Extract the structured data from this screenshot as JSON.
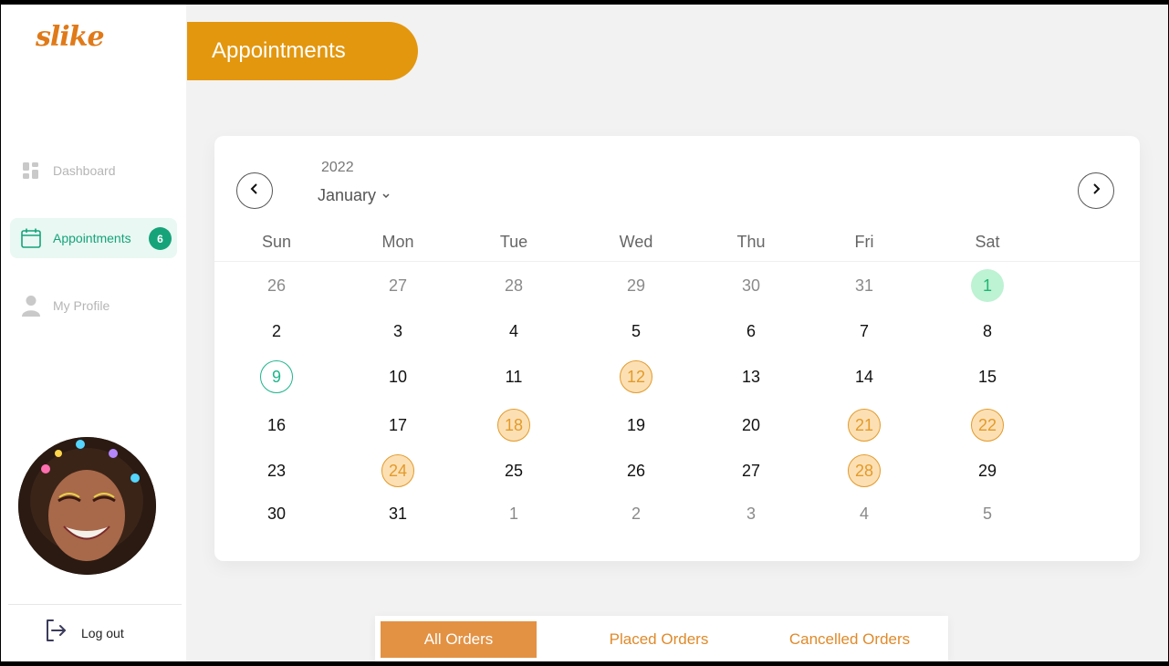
{
  "brand": {
    "logo": "slike"
  },
  "sidebar": {
    "items": [
      {
        "label": "Dashboard",
        "icon": "dashboard-icon"
      },
      {
        "label": "Appointments",
        "icon": "calendar-icon",
        "badge": "6"
      },
      {
        "label": "My Profile",
        "icon": "user-icon"
      }
    ],
    "logout": "Log out"
  },
  "header": {
    "title": "Appointments"
  },
  "calendar": {
    "year": "2022",
    "month": "January",
    "weekdays": [
      "Sun",
      "Mon",
      "Tue",
      "Wed",
      "Thu",
      "Fri",
      "Sat"
    ],
    "weeks": [
      [
        {
          "d": "26",
          "state": "muted"
        },
        {
          "d": "27",
          "state": "muted"
        },
        {
          "d": "28",
          "state": "muted"
        },
        {
          "d": "29",
          "state": "muted"
        },
        {
          "d": "30",
          "state": "muted"
        },
        {
          "d": "31",
          "state": "muted"
        },
        {
          "d": "1",
          "state": "today"
        }
      ],
      [
        {
          "d": "2"
        },
        {
          "d": "3"
        },
        {
          "d": "4"
        },
        {
          "d": "5"
        },
        {
          "d": "6"
        },
        {
          "d": "7"
        },
        {
          "d": "8"
        }
      ],
      [
        {
          "d": "9",
          "state": "selected"
        },
        {
          "d": "10"
        },
        {
          "d": "11"
        },
        {
          "d": "12",
          "state": "appt"
        },
        {
          "d": "13"
        },
        {
          "d": "14"
        },
        {
          "d": "15"
        }
      ],
      [
        {
          "d": "16"
        },
        {
          "d": "17"
        },
        {
          "d": "18",
          "state": "appt"
        },
        {
          "d": "19"
        },
        {
          "d": "20"
        },
        {
          "d": "21",
          "state": "appt"
        },
        {
          "d": "22",
          "state": "appt"
        }
      ],
      [
        {
          "d": "23"
        },
        {
          "d": "24",
          "state": "appt"
        },
        {
          "d": "25"
        },
        {
          "d": "26"
        },
        {
          "d": "27"
        },
        {
          "d": "28",
          "state": "appt"
        },
        {
          "d": "29"
        }
      ],
      [
        {
          "d": "30"
        },
        {
          "d": "31"
        },
        {
          "d": "1",
          "state": "muted"
        },
        {
          "d": "2",
          "state": "muted"
        },
        {
          "d": "3",
          "state": "muted"
        },
        {
          "d": "4",
          "state": "muted"
        },
        {
          "d": "5",
          "state": "muted"
        }
      ]
    ]
  },
  "tabs": [
    {
      "label": "All Orders",
      "active": true
    },
    {
      "label": "Placed Orders",
      "active": false
    },
    {
      "label": "Cancelled Orders",
      "active": false
    }
  ],
  "colors": {
    "accent": "#e3970f",
    "green": "#16a37a",
    "appointment_fill": "#fce0b4",
    "appointment_text": "#e39a2a"
  }
}
